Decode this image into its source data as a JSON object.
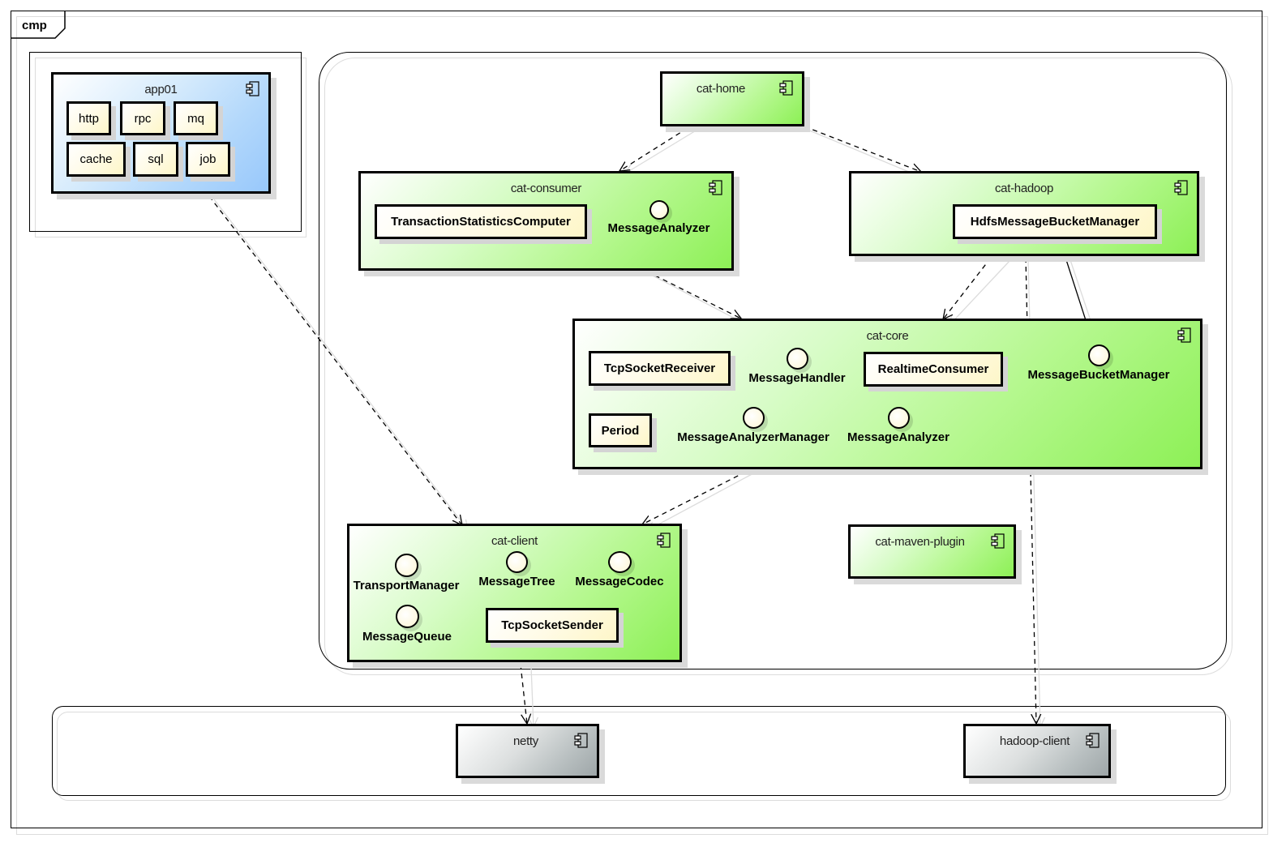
{
  "diagram": {
    "frame_label": "cmp",
    "colors": {
      "component_green_end": "#8df056",
      "component_blue_end": "#98c8fb",
      "component_gray_end": "#9ea6a8",
      "class_fill": "#fdf6c8",
      "line": "#000000"
    },
    "components": {
      "app01": {
        "name": "app01",
        "classes": [
          "http",
          "rpc",
          "mq",
          "cache",
          "sql",
          "job"
        ]
      },
      "cat_home": {
        "name": "cat-home"
      },
      "cat_consumer": {
        "name": "cat-consumer",
        "classes": [
          "TransactionStatisticsComputer"
        ],
        "interfaces": [
          "MessageAnalyzer"
        ]
      },
      "cat_hadoop": {
        "name": "cat-hadoop",
        "classes": [
          "HdfsMessageBucketManager"
        ]
      },
      "cat_core": {
        "name": "cat-core",
        "classes": [
          "TcpSocketReceiver",
          "RealtimeConsumer",
          "Period"
        ],
        "interfaces": [
          "MessageHandler",
          "MessageBucketManager",
          "MessageAnalyzerManager",
          "MessageAnalyzer"
        ]
      },
      "cat_client": {
        "name": "cat-client",
        "classes": [
          "TcpSocketSender"
        ],
        "interfaces": [
          "TransportManager",
          "MessageTree",
          "MessageCodec",
          "MessageQueue"
        ]
      },
      "cat_maven_plugin": {
        "name": "cat-maven-plugin"
      },
      "netty": {
        "name": "netty"
      },
      "hadoop_client": {
        "name": "hadoop-client"
      }
    },
    "dependencies": [
      {
        "from": "app01",
        "to": "cat-client",
        "type": "dependency"
      },
      {
        "from": "cat-home",
        "to": "cat-consumer",
        "type": "dependency"
      },
      {
        "from": "cat-home",
        "to": "cat-hadoop",
        "type": "dependency"
      },
      {
        "from": "cat-consumer",
        "to": "cat-core",
        "type": "dependency"
      },
      {
        "from": "cat-hadoop",
        "to": "cat-core",
        "type": "dependency"
      },
      {
        "from": "cat-hadoop",
        "to": "hadoop-client",
        "type": "dependency"
      },
      {
        "from": "HdfsMessageBucketManager",
        "to": "MessageBucketManager",
        "type": "realization"
      },
      {
        "from": "cat-core",
        "to": "cat-client",
        "type": "dependency"
      },
      {
        "from": "cat-client",
        "to": "netty",
        "type": "dependency"
      }
    ]
  }
}
